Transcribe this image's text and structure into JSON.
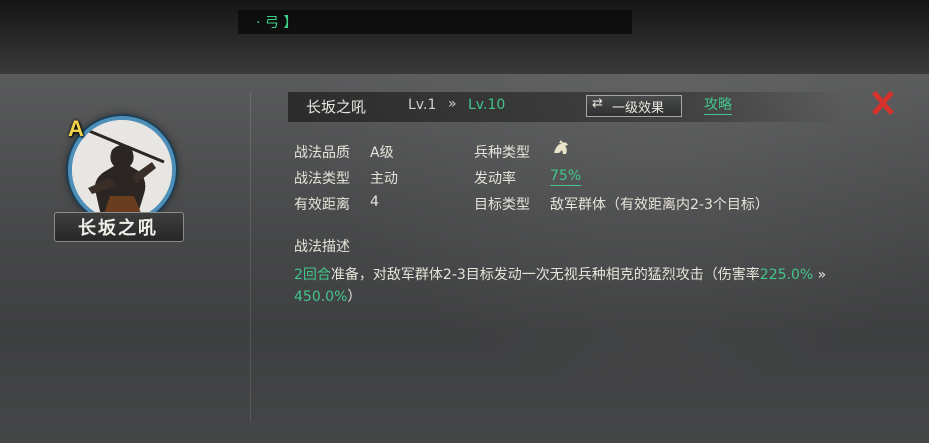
{
  "top_bar": {
    "title_fragment": "· 弓 】"
  },
  "tactic": {
    "grade_letter": "A",
    "name": "长坂之吼",
    "nameplate_text": "长坂之吼",
    "level_from": "Lv.1",
    "level_arrow": "»",
    "level_to": "Lv.10",
    "effect_button_icon": "⇄",
    "effect_button_label": "一级效果",
    "strategy_link": "攻略"
  },
  "info": {
    "quality_label": "战法品质",
    "quality_value": "A级",
    "type_label": "战法类型",
    "type_value": "主动",
    "range_label": "有效距离",
    "range_value": "4",
    "troop_label": "兵种类型",
    "troop_icon": "cavalry-troop-icon",
    "trigger_label": "发动率",
    "trigger_value": "75%",
    "target_label": "目标类型",
    "target_value": "敌军群体（有效距离内2-3个目标）"
  },
  "description": {
    "title": "战法描述",
    "rounds": "2回合",
    "text_a": "准备，对敌军群体2-3目标发动一次无视兵种相克的猛烈攻击（伤害率",
    "dmg_from": "225.0%",
    "arrow": " » ",
    "dmg_to": "450.0%",
    "text_b": "）"
  },
  "colors": {
    "accent_green": "#43c58c",
    "close_red": "#d8322c",
    "grade_gold": "#f1d34a"
  }
}
